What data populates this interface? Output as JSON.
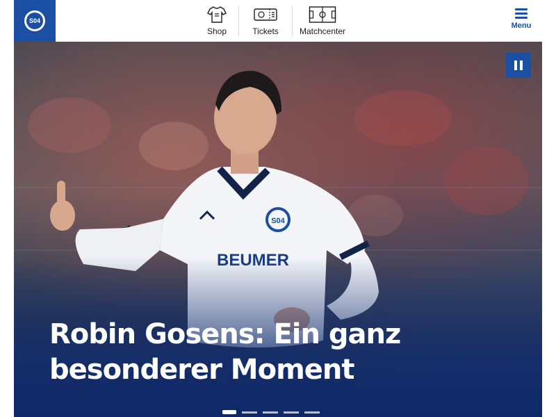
{
  "header": {
    "logo_text": "S04",
    "nav": [
      {
        "label": "Shop",
        "icon": "jersey-icon"
      },
      {
        "label": "Tickets",
        "icon": "ticket-icon"
      },
      {
        "label": "Matchcenter",
        "icon": "pitch-icon"
      }
    ],
    "menu_label": "Menu"
  },
  "hero": {
    "headline_line1": "Robin Gosens: Ein ganz",
    "headline_line2": "besonderer Moment",
    "shirt_sponsor": "BEUMER",
    "pause_icon": "pause-icon",
    "slides": 5,
    "active_slide": 1
  },
  "colors": {
    "brand_blue": "#1a4fa3",
    "white": "#ffffff"
  }
}
